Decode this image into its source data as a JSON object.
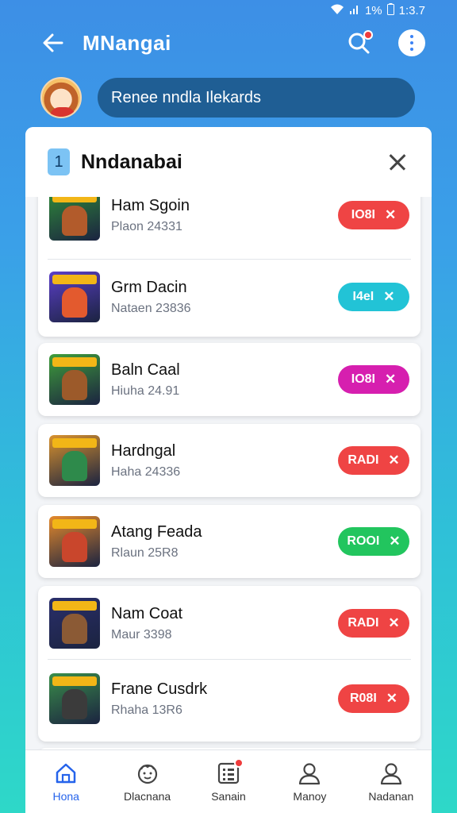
{
  "status_bar": {
    "battery": "1%",
    "time": "1:3.7"
  },
  "app_bar": {
    "title": "MNangai",
    "back_icon": "arrow-left-icon",
    "search_icon": "search-icon",
    "more_icon": "more-vertical-icon"
  },
  "search": {
    "text": "Renee nndla Ilekards"
  },
  "panel": {
    "badge": "1",
    "title": "Nndanabai"
  },
  "games": [
    {
      "name": "Ham Sgoin",
      "sub": "Plaon 24331",
      "action": "IO8I",
      "color": "#ef4444",
      "thumb_bg": "#2f8a3a",
      "char": "#b25b2b"
    },
    {
      "name": "Grm Dacin",
      "sub": "Nataen 23836",
      "action": "I4eI",
      "color": "#22c3d6",
      "thumb_bg": "#5b3fc8",
      "char": "#e35a2e"
    },
    {
      "name": "Baln Caal",
      "sub": "Hiuha 24.91",
      "action": "IO8I",
      "color": "#d61faf",
      "thumb_bg": "#3f9e3b",
      "char": "#9c5a2a"
    },
    {
      "name": "Hardngal",
      "sub": "Haha 24336",
      "action": "RADI",
      "color": "#ef4444",
      "thumb_bg": "#d9922e",
      "char": "#2e8a4b"
    },
    {
      "name": "Atang Feada",
      "sub": "Rlaun 25R8",
      "action": "ROOI",
      "color": "#22c55e",
      "thumb_bg": "#e58a2c",
      "char": "#c9462c"
    },
    {
      "name": "Nam Coat",
      "sub": "Maur 3398",
      "action": "RADI",
      "color": "#ef4444",
      "thumb_bg": "#2a2f6b",
      "char": "#8b5a35"
    },
    {
      "name": "Frane Cusdrk",
      "sub": "Rhaha 13R6",
      "action": "R08I",
      "color": "#ef4444",
      "thumb_bg": "#3a8e4a",
      "char": "#3b3b3b"
    }
  ],
  "nav": [
    {
      "label": "Hona",
      "icon": "home-icon",
      "active": true
    },
    {
      "label": "Dlacnana",
      "icon": "face-icon",
      "active": false
    },
    {
      "label": "Sanain",
      "icon": "list-icon",
      "active": false
    },
    {
      "label": "Manoy",
      "icon": "person-icon",
      "active": false
    },
    {
      "label": "Nadanan",
      "icon": "account-icon",
      "active": false
    }
  ],
  "colors": {
    "accent": "#2563eb",
    "header_gradient_top": "#3d8fe6",
    "header_gradient_bottom": "#2ed8c8"
  }
}
